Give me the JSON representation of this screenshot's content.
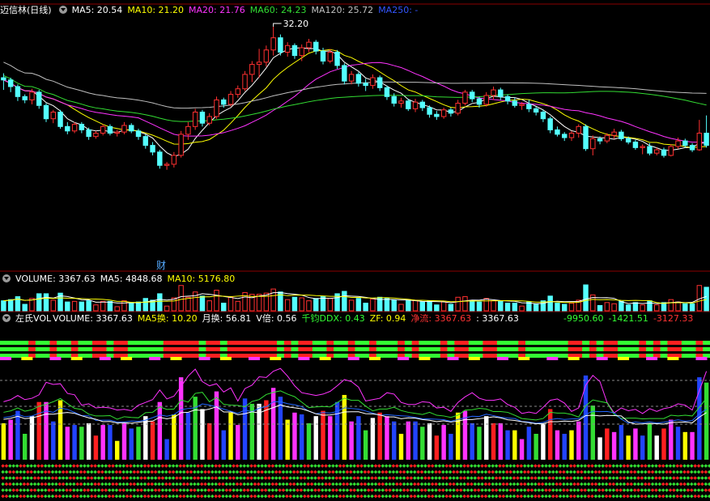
{
  "price_header": {
    "stock_name": "迈信林(日线)",
    "indicators": [
      {
        "label": "MA5: 20.54",
        "color": "#ffffff"
      },
      {
        "label": "MA10: 21.20",
        "color": "#ffff00"
      },
      {
        "label": "MA20: 21.76",
        "color": "#ff33ff"
      },
      {
        "label": "MA60: 24.23",
        "color": "#33dd33"
      },
      {
        "label": "MA120: 25.72",
        "color": "#c0c0c0"
      },
      {
        "label": "MA250: -",
        "color": "#3355ff"
      }
    ]
  },
  "annotations": {
    "high_label": "32.20",
    "event_label": "财"
  },
  "volume_header": {
    "title": "VOLUME: 3367.63",
    "items": [
      {
        "label": "MA5: 4848.68",
        "color": "#ffffff"
      },
      {
        "label": "MA10: 5176.80",
        "color": "#ffff00"
      }
    ]
  },
  "indicator_header": {
    "title": "左氏VOL",
    "items": [
      {
        "label": "VOLUME: 3367.63",
        "color": "#ffffff"
      },
      {
        "label": "MA5换: 10.20",
        "color": "#ffff00"
      },
      {
        "label": "月换: 56.81",
        "color": "#ffffff"
      },
      {
        "label": "V倍: 0.56",
        "color": "#ffffff"
      },
      {
        "label": "千钧DDX: 0.43",
        "color": "#33ff33"
      },
      {
        "label": "ZF: 0.94",
        "color": "#ffff00"
      },
      {
        "label": "净流: 3367.63",
        "color": "#ff3333"
      },
      {
        "label": ": 3367.63",
        "color": "#ffffff"
      }
    ],
    "right_values": [
      {
        "label": "-9950.60",
        "color": "#33ff33"
      },
      {
        "label": "-1421.51",
        "color": "#33ff33"
      },
      {
        "label": "-3127.33",
        "color": "#ff3333"
      }
    ]
  },
  "chart_data": {
    "type": "candlestick",
    "ylim": [
      16,
      33
    ],
    "high_marker": 32.2,
    "candles": [
      [
        27.6,
        28.0,
        26.5,
        27.4
      ],
      [
        27.4,
        27.6,
        26.3,
        26.8
      ],
      [
        26.8,
        27.0,
        25.5,
        25.9
      ],
      [
        25.9,
        26.1,
        25.3,
        25.6
      ],
      [
        25.6,
        26.6,
        25.2,
        26.3
      ],
      [
        26.3,
        26.5,
        24.8,
        25.1
      ],
      [
        25.1,
        25.3,
        23.6,
        23.9
      ],
      [
        23.9,
        24.7,
        23.5,
        24.5
      ],
      [
        24.5,
        24.7,
        23.0,
        23.2
      ],
      [
        23.2,
        23.6,
        22.5,
        22.8
      ],
      [
        22.8,
        23.6,
        22.6,
        23.4
      ],
      [
        23.4,
        23.6,
        22.6,
        22.9
      ],
      [
        22.9,
        23.1,
        22.0,
        22.3
      ],
      [
        22.3,
        22.8,
        22.1,
        22.6
      ],
      [
        22.6,
        23.4,
        22.4,
        23.2
      ],
      [
        23.2,
        23.4,
        22.4,
        22.6
      ],
      [
        22.6,
        22.9,
        22.3,
        22.7
      ],
      [
        22.7,
        23.6,
        22.5,
        23.3
      ],
      [
        23.3,
        23.5,
        22.6,
        22.8
      ],
      [
        22.8,
        23.0,
        22.0,
        22.3
      ],
      [
        22.3,
        22.5,
        21.2,
        21.5
      ],
      [
        21.5,
        21.8,
        20.6,
        20.9
      ],
      [
        20.9,
        21.1,
        19.4,
        19.7
      ],
      [
        19.7,
        20.0,
        19.3,
        19.8
      ],
      [
        19.8,
        20.9,
        19.5,
        20.6
      ],
      [
        20.6,
        22.8,
        20.4,
        22.5
      ],
      [
        22.5,
        23.6,
        22.0,
        23.2
      ],
      [
        23.2,
        24.8,
        22.9,
        24.5
      ],
      [
        24.5,
        24.7,
        23.2,
        23.5
      ],
      [
        23.5,
        24.4,
        23.3,
        24.1
      ],
      [
        24.1,
        25.9,
        23.9,
        25.6
      ],
      [
        25.6,
        25.8,
        24.9,
        25.2
      ],
      [
        25.2,
        26.4,
        25.0,
        26.1
      ],
      [
        26.1,
        26.9,
        25.8,
        26.6
      ],
      [
        26.6,
        28.2,
        26.4,
        27.9
      ],
      [
        27.9,
        29.1,
        27.2,
        28.8
      ],
      [
        28.8,
        30.2,
        27.6,
        29.0
      ],
      [
        29.0,
        30.5,
        28.6,
        30.1
      ],
      [
        30.1,
        32.2,
        29.6,
        31.2
      ],
      [
        31.2,
        31.5,
        29.6,
        29.9
      ],
      [
        29.9,
        30.8,
        29.5,
        30.5
      ],
      [
        30.5,
        30.7,
        29.3,
        29.6
      ],
      [
        29.6,
        30.6,
        29.1,
        30.3
      ],
      [
        30.3,
        31.1,
        29.9,
        30.8
      ],
      [
        30.8,
        31.0,
        29.7,
        30.0
      ],
      [
        30.0,
        30.3,
        28.8,
        29.1
      ],
      [
        29.1,
        30.2,
        28.9,
        29.9
      ],
      [
        29.9,
        30.1,
        28.4,
        28.7
      ],
      [
        28.7,
        28.9,
        27.0,
        27.3
      ],
      [
        27.3,
        28.2,
        27.0,
        27.9
      ],
      [
        27.9,
        28.1,
        26.8,
        27.1
      ],
      [
        27.1,
        27.5,
        26.4,
        26.9
      ],
      [
        26.9,
        27.9,
        26.6,
        27.6
      ],
      [
        27.6,
        27.8,
        26.4,
        26.7
      ],
      [
        26.7,
        26.9,
        25.6,
        25.9
      ],
      [
        25.9,
        26.2,
        25.0,
        25.3
      ],
      [
        25.3,
        25.8,
        24.9,
        25.5
      ],
      [
        25.5,
        25.7,
        24.6,
        24.8
      ],
      [
        24.8,
        25.7,
        24.5,
        25.4
      ],
      [
        25.4,
        25.6,
        24.6,
        24.9
      ],
      [
        24.9,
        25.1,
        24.0,
        24.3
      ],
      [
        24.3,
        24.6,
        23.8,
        24.1
      ],
      [
        24.1,
        24.9,
        23.9,
        24.7
      ],
      [
        24.7,
        24.9,
        24.1,
        24.4
      ],
      [
        24.4,
        25.6,
        24.2,
        25.3
      ],
      [
        25.3,
        26.5,
        25.1,
        26.3
      ],
      [
        26.3,
        26.5,
        25.4,
        25.7
      ],
      [
        25.7,
        25.9,
        24.9,
        25.2
      ],
      [
        25.2,
        26.3,
        25.0,
        26.0
      ],
      [
        26.0,
        26.8,
        25.6,
        26.5
      ],
      [
        26.5,
        26.7,
        25.6,
        25.9
      ],
      [
        25.9,
        26.1,
        25.2,
        25.5
      ],
      [
        25.5,
        25.8,
        24.9,
        25.1
      ],
      [
        25.1,
        25.4,
        24.7,
        25.2
      ],
      [
        25.2,
        25.6,
        24.5,
        24.8
      ],
      [
        24.8,
        25.0,
        24.2,
        24.5
      ],
      [
        24.5,
        24.7,
        23.6,
        23.9
      ],
      [
        23.9,
        24.1,
        22.6,
        22.9
      ],
      [
        22.9,
        23.2,
        22.3,
        22.5
      ],
      [
        22.5,
        22.7,
        21.9,
        22.2
      ],
      [
        22.2,
        22.8,
        21.9,
        22.6
      ],
      [
        22.6,
        23.4,
        22.2,
        23.2
      ],
      [
        23.2,
        23.4,
        21.0,
        21.2
      ],
      [
        21.2,
        22.4,
        20.6,
        22.1
      ],
      [
        22.1,
        22.3,
        21.6,
        21.9
      ],
      [
        21.9,
        22.6,
        21.7,
        22.4
      ],
      [
        22.4,
        23.0,
        22.1,
        22.7
      ],
      [
        22.7,
        22.9,
        21.9,
        22.1
      ],
      [
        22.1,
        22.3,
        21.6,
        21.8
      ],
      [
        21.8,
        22.0,
        21.1,
        21.3
      ],
      [
        21.3,
        21.6,
        20.7,
        21.4
      ],
      [
        21.4,
        21.7,
        20.6,
        20.8
      ],
      [
        20.8,
        21.3,
        20.6,
        21.1
      ],
      [
        21.1,
        21.3,
        20.4,
        20.6
      ],
      [
        20.6,
        21.6,
        20.5,
        21.4
      ],
      [
        21.4,
        22.2,
        21.2,
        21.9
      ],
      [
        21.9,
        22.1,
        21.3,
        21.5
      ],
      [
        21.5,
        21.7,
        20.9,
        21.1
      ],
      [
        21.1,
        23.8,
        21.0,
        22.6
      ],
      [
        22.6,
        24.2,
        21.3,
        21.5
      ]
    ]
  }
}
